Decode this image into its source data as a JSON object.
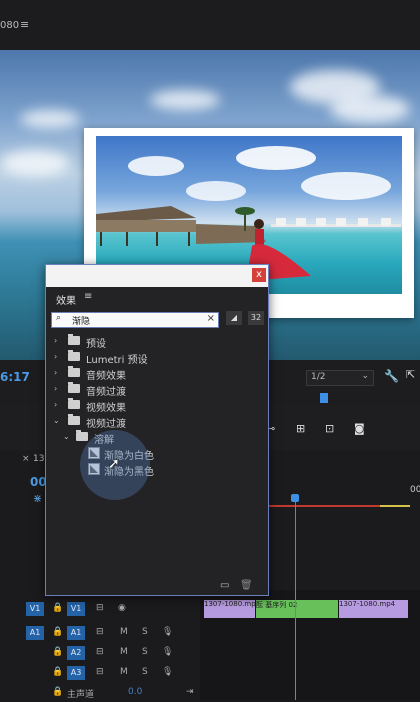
{
  "topbar": {
    "left_text": "080",
    "menu_icon": "hamburger-icon"
  },
  "monitor": {
    "timecode": "6:17",
    "zoom": "1/2"
  },
  "effects_panel": {
    "close_label": "x",
    "tab_label": "效果",
    "menu_glyph": "≡",
    "search_value": "渐隐",
    "search_clear": "×",
    "btn_a": "◢",
    "btn_b": "32",
    "items": [
      {
        "label": "预设",
        "expanded": false
      },
      {
        "label": "Lumetri 预设",
        "expanded": false
      },
      {
        "label": "音频效果",
        "expanded": false
      },
      {
        "label": "音频过渡",
        "expanded": false
      },
      {
        "label": "视频效果",
        "expanded": false
      },
      {
        "label": "视频过渡",
        "expanded": true
      },
      {
        "label": "溶解",
        "expanded": true,
        "depth": 1
      },
      {
        "label": "渐隐为白色",
        "type": "effect",
        "depth": 2
      },
      {
        "label": "渐隐为黑色",
        "type": "effect",
        "depth": 2
      }
    ]
  },
  "timeline": {
    "seq_tab": "130",
    "timecode_short": "00",
    "ruler_tail": "00",
    "tracks": [
      {
        "name": "V1",
        "target": "V1",
        "ctrl": "视频"
      },
      {
        "name": "A1",
        "target": "A1",
        "m": "M",
        "s": "S"
      },
      {
        "name": "A2",
        "target": "A2",
        "m": "M",
        "s": "S"
      },
      {
        "name": "A3",
        "target": "A3",
        "m": "M",
        "s": "S"
      }
    ],
    "clips": [
      {
        "label": "1307-1080.mp4",
        "color": "#b79be0"
      },
      {
        "label": "酝 基序列 02",
        "color": "#67c05a"
      },
      {
        "label": "1307-1080.mp4",
        "color": "#b79be0"
      }
    ],
    "master_label": "主声道",
    "master_value": "0.0"
  },
  "colors": {
    "accent": "#3e8fe6",
    "track_blue": "#2463a8",
    "close_red": "#d6403a"
  }
}
